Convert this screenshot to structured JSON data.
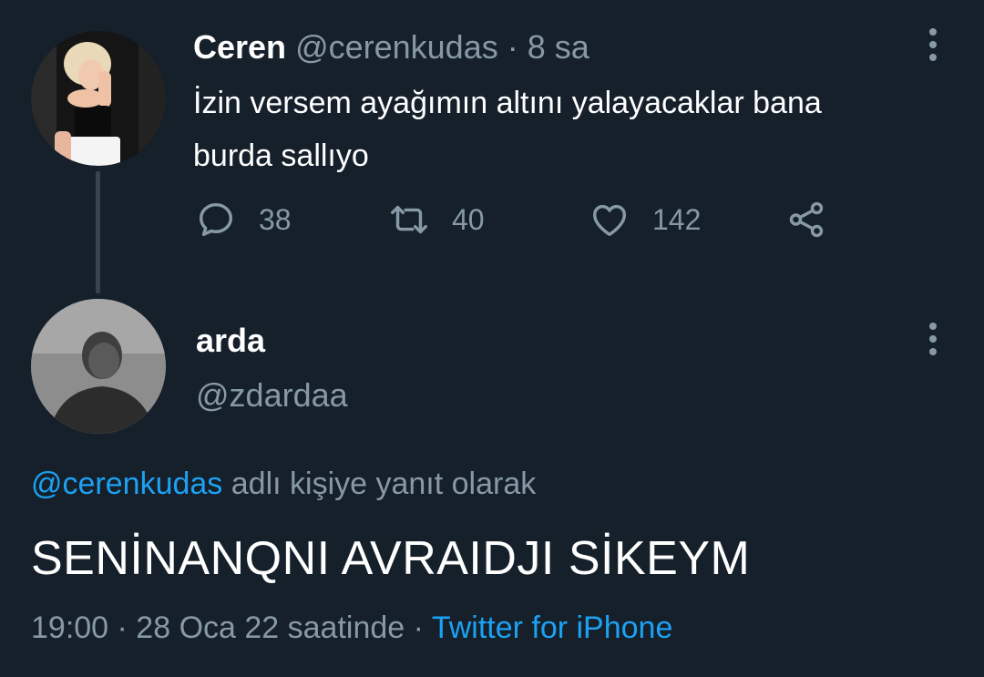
{
  "parent_tweet": {
    "display_name": "Ceren",
    "handle": "@cerenkudas",
    "separator": "·",
    "time": "8 sa",
    "text_line1": "İzin versem ayağımın altını yalayacaklar bana",
    "text_line2": "burda sallıyo",
    "actions": {
      "reply_count": "38",
      "retweet_count": "40",
      "like_count": "142"
    }
  },
  "reply_tweet": {
    "display_name": "arda",
    "handle": "@zdardaa",
    "replying_to_handle": "@cerenkudas",
    "replying_to_suffix": "adlı kişiye yanıt olarak",
    "text": "SENİNANQNI AVRAIDJI SİKEYM",
    "timestamp": "19:00 · 28 Oca 22 saatinde",
    "separator": "·",
    "source": "Twitter for iPhone"
  },
  "colors": {
    "background": "#15202b",
    "muted": "#8899a6",
    "link": "#1da1f2",
    "thread_line": "#38444d"
  }
}
